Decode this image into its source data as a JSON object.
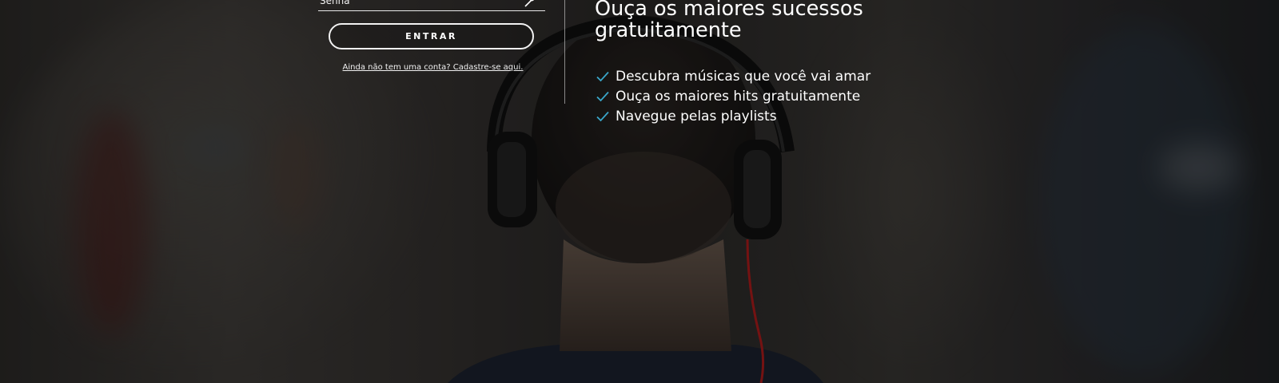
{
  "login": {
    "password_value": "Senha",
    "submit_label": "ENTRAR",
    "signup_link": "Ainda não tem uma conta? Cadastre-se aqui."
  },
  "hero": {
    "headline_line1": "Ouça os maiores sucessos",
    "headline_line2": "gratuitamente",
    "features": [
      "Descubra músicas que você vai amar",
      "Ouça os maiores hits gratuitamente",
      "Navegue pelas playlists"
    ]
  },
  "colors": {
    "accent_check": "#3aa6c9",
    "text": "#ffffff"
  },
  "icons": {
    "password_toggle": "eye-icon",
    "feature_bullet": "check-icon"
  }
}
